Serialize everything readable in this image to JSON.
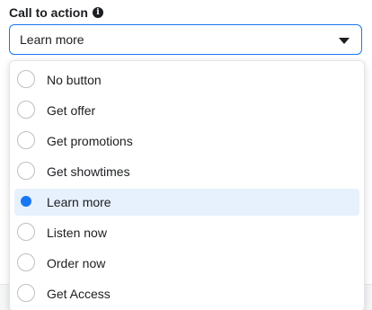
{
  "field": {
    "label": "Call to action",
    "info_icon": "i"
  },
  "select": {
    "value": "Learn more",
    "icon": "caret-down-icon"
  },
  "menu": {
    "options": [
      {
        "label": "No button",
        "selected": false
      },
      {
        "label": "Get offer",
        "selected": false
      },
      {
        "label": "Get promotions",
        "selected": false
      },
      {
        "label": "Get showtimes",
        "selected": false
      },
      {
        "label": "Learn more",
        "selected": true
      },
      {
        "label": "Listen now",
        "selected": false
      },
      {
        "label": "Order now",
        "selected": false
      },
      {
        "label": "Get Access",
        "selected": false
      }
    ]
  },
  "colors": {
    "accent": "#1877f2",
    "selected_bg": "#e7f0fd",
    "text": "#1c1e21",
    "border": "#bcc0c4"
  }
}
